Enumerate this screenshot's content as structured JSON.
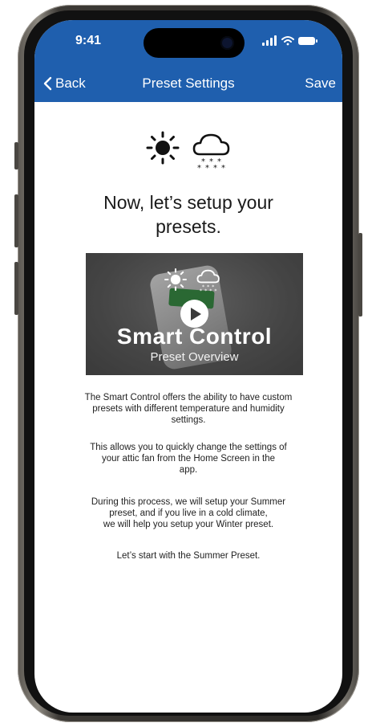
{
  "status": {
    "time": "9:41"
  },
  "nav": {
    "back_label": "Back",
    "title": "Preset Settings",
    "save_label": "Save"
  },
  "icons": {
    "weather": [
      "sun-icon",
      "snow-cloud-icon"
    ],
    "status": [
      "cellular-signal-icon",
      "wifi-icon",
      "battery-icon"
    ],
    "video": [
      "sun-icon",
      "snow-cloud-icon",
      "play-icon"
    ]
  },
  "colors": {
    "header": "#1f5fae",
    "video_accent": "#2c8a3a"
  },
  "content": {
    "heading_line1": "Now, let’s setup your",
    "heading_line2": "presets.",
    "video": {
      "title": "Smart Control",
      "subtitle": "Preset Overview"
    },
    "paragraphs": [
      [
        "The Smart Control offers the ability to have custom",
        "presets with different temperature and humidity",
        "settings."
      ],
      [
        "This allows you to quickly change the settings of",
        "your attic fan from the Home Screen in the",
        "app."
      ],
      [
        "During this process, we will setup your Summer",
        "preset, and if you live in a cold climate,",
        "we will help you setup your Winter preset."
      ],
      [
        "Let’s start with the Summer Preset."
      ]
    ]
  }
}
